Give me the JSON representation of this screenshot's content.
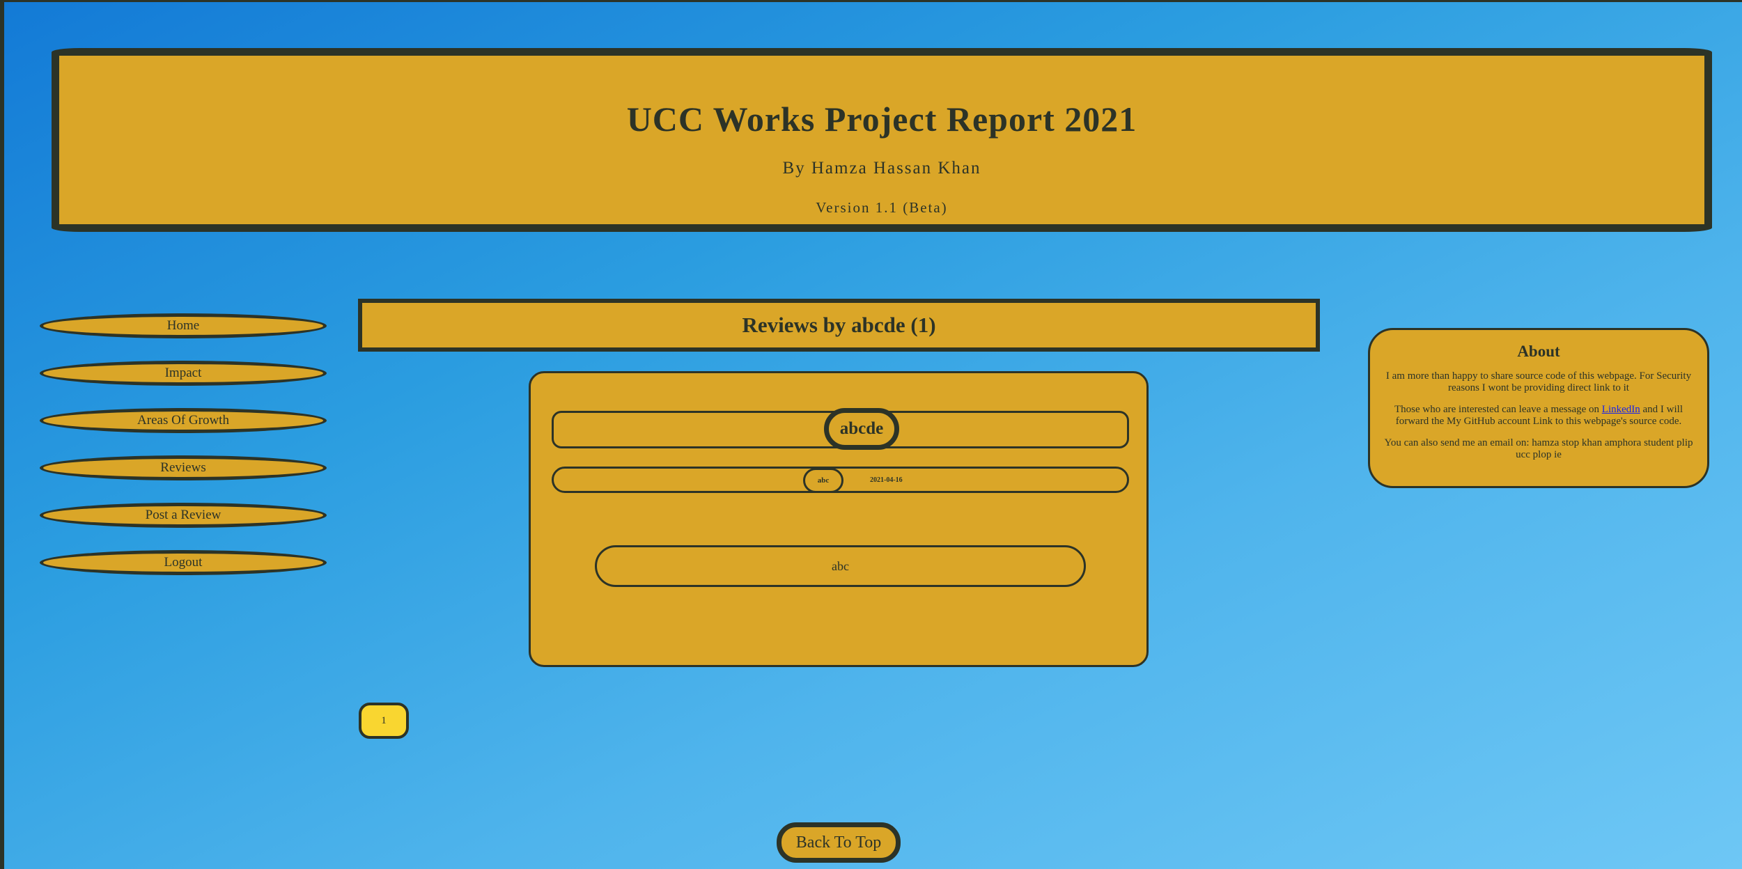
{
  "header": {
    "title": "UCC Works Project Report 2021",
    "byline": "By Hamza Hassan Khan",
    "version": "Version 1.1 (Beta)"
  },
  "nav": {
    "items": [
      {
        "label": "Home"
      },
      {
        "label": "Impact"
      },
      {
        "label": "Areas Of Growth"
      },
      {
        "label": "Reviews"
      },
      {
        "label": "Post a Review"
      },
      {
        "label": "Logout"
      }
    ]
  },
  "main": {
    "heading": "Reviews by abcde (1)",
    "review": {
      "title": "abcde",
      "author": "abc",
      "date": "2021-04-16",
      "body": "abc"
    },
    "pagination": {
      "current_page": "1"
    }
  },
  "about": {
    "heading": "About",
    "para1": "I am more than happy to share source code of this webpage. For Security reasons I wont be providing direct link to it",
    "para2_before": "Those who are interested can leave a message on ",
    "para2_link": "LinkedIn",
    "para2_after": " and I will forward the My GitHub account Link to this webpage's source code.",
    "para3": "You can also send me an email on: hamza stop khan amphora student plip ucc plop ie"
  },
  "footer": {
    "back_to_top": "Back To Top"
  },
  "colors": {
    "panel": "#daa628",
    "border": "#2c3327",
    "active_page": "#f9d630",
    "link": "#1a23e6"
  }
}
